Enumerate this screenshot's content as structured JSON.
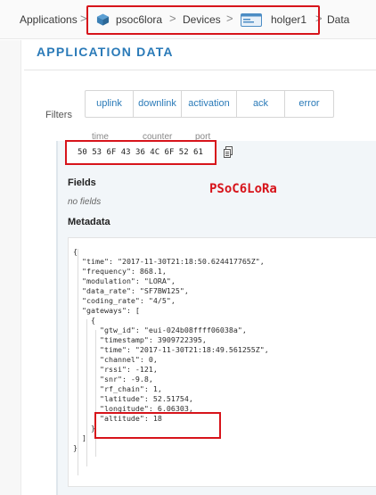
{
  "breadcrumb": {
    "items": [
      "Applications",
      "psoc6lora",
      "Devices",
      "holger1",
      "Data"
    ],
    "separator": ">"
  },
  "page": {
    "title": "APPLICATION DATA"
  },
  "filters": {
    "label": "Filters",
    "buttons": [
      "uplink",
      "downlink",
      "activation",
      "ack",
      "error"
    ]
  },
  "table_headers": [
    "time",
    "counter",
    "port"
  ],
  "payload": {
    "hex": "50 53 6F 43 36 4C 6F 52 61"
  },
  "annotation": "PSoC6LoRa",
  "fields": {
    "heading": "Fields",
    "empty_text": "no fields"
  },
  "metadata": {
    "heading": "Metadata",
    "lines": [
      "{",
      "  \"time\": \"2017-11-30T21:18:50.624417765Z\",",
      "  \"frequency\": 868.1,",
      "  \"modulation\": \"LORA\",",
      "  \"data_rate\": \"SF7BW125\",",
      "  \"coding_rate\": \"4/5\",",
      "  \"gateways\": [",
      "    {",
      "      \"gtw_id\": \"eui-024b08ffff06038a\",",
      "      \"timestamp\": 3909722395,",
      "      \"time\": \"2017-11-30T21:18:49.561255Z\",",
      "      \"channel\": 0,",
      "      \"rssi\": -121,",
      "      \"snr\": -9.8,",
      "      \"rf_chain\": 1,",
      "      \"latitude\": 52.51754,",
      "      \"longitude\": 6.06303,",
      "      \"altitude\": 18",
      "    }",
      "  ]",
      "}"
    ]
  },
  "colors": {
    "accent": "#2a7ab8",
    "highlight": "#d7141b",
    "card_bg": "#f2f6f9"
  },
  "icons": [
    "application-cube-icon",
    "device-icon",
    "copy-icon"
  ]
}
